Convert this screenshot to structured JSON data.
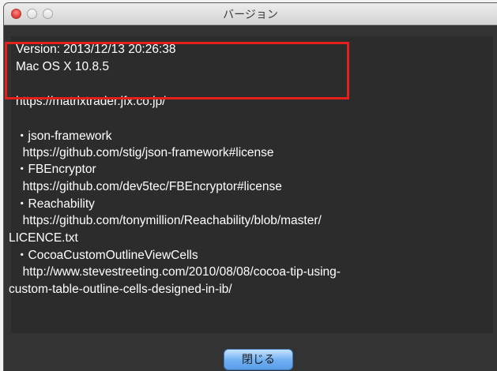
{
  "window": {
    "title": "バージョン"
  },
  "about": {
    "version": "Version: 2013/12/13 20:26:38",
    "os": "Mac OS X 10.8.5",
    "url": "https://matrixtrader.jfx.co.jp/",
    "credits": [
      "・json-framework",
      "  https://github.com/stig/json-framework#license",
      "・FBEncryptor",
      "  https://github.com/dev5tec/FBEncryptor#license",
      "・Reachability",
      "  https://github.com/tonymillion/Reachability/blob/master/",
      "LICENCE.txt",
      "・CocoaCustomOutlineViewCells",
      "  http://www.stevestreeting.com/2010/08/08/cocoa-tip-using-",
      "custom-table-outline-cells-designed-in-ib/"
    ]
  },
  "footer": {
    "close_label": "閉じる"
  },
  "colors": {
    "highlight": "#e4201c",
    "button": "#6eaef2",
    "content_bg": "#2c2c2c"
  }
}
